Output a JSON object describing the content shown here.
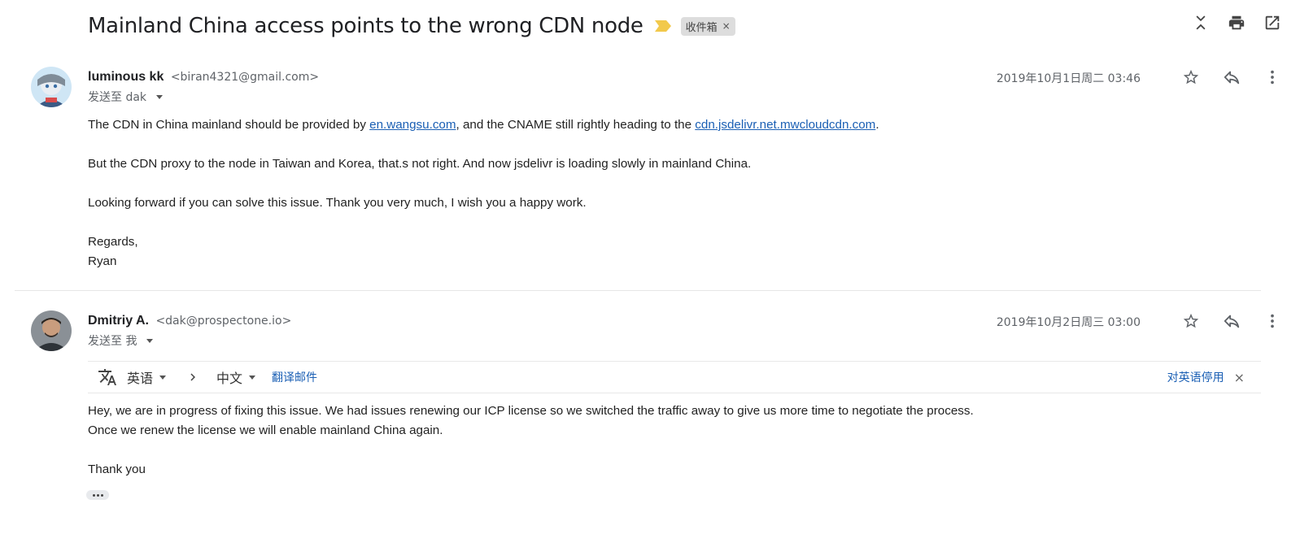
{
  "subject": "Mainland China access points to the wrong CDN node",
  "label_chip": {
    "text": "收件箱",
    "close": "×"
  },
  "important_color": "#f2c94c",
  "link_color": "#1a5fb4",
  "top_actions": [
    "collapse-icon",
    "print-icon",
    "open-in-new-window-icon"
  ],
  "messages": [
    {
      "sender_name": "luminous kk",
      "sender_email": "<biran4321@gmail.com>",
      "to_text": "发送至 dak",
      "date": "2019年10月1日周二 03:46",
      "body": {
        "line1_a": "The CDN in China mainland should be provided by ",
        "link1": "en.wangsu.com",
        "line1_b": ", and the CNAME still rightly heading to the ",
        "link2": "cdn.jsdelivr.net.mwcloudcdn.com",
        "line1_c": ".",
        "line2": "But the CDN proxy to the node in Taiwan and Korea, that.s not right. And now jsdelivr is loading slowly in mainland China.",
        "line3": "Looking forward if you can solve this issue. Thank you very much, I wish you a happy work.",
        "line4": "Regards,",
        "line5": "Ryan"
      }
    },
    {
      "sender_name": "Dmitriy A.",
      "sender_email": "<dak@prospectone.io>",
      "to_text": "发送至 我",
      "date": "2019年10月2日周三 03:00",
      "translate_bar": {
        "from_lang": "英语",
        "to_lang": "中文",
        "translate_link": "翻译邮件",
        "disable_link": "对英语停用",
        "close": "×"
      },
      "body": {
        "line1": "Hey, we are in progress of fixing this issue. We had issues renewing our ICP license so we switched the traffic away to give us more time to negotiate the process.",
        "line2": "Once we renew the license we will enable mainland China again.",
        "line3": "Thank you"
      }
    }
  ]
}
